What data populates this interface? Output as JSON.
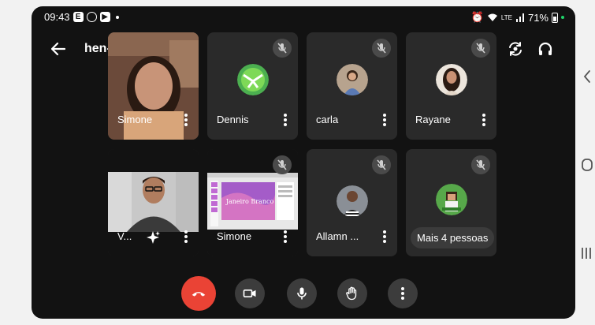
{
  "status": {
    "time": "09:43",
    "battery": "71%",
    "network": "LTE"
  },
  "header": {
    "title": "hen-xxcf-sux"
  },
  "participants": [
    {
      "name": "Simone"
    },
    {
      "name": "Dennis"
    },
    {
      "name": "carla"
    },
    {
      "name": "Rayane"
    },
    {
      "name": "V..."
    },
    {
      "name": "Simone"
    },
    {
      "name": "Allamn ..."
    },
    {
      "name": "Mais 4 pessoas"
    }
  ],
  "shared_slide": {
    "text": "Janeiro Branco"
  },
  "colors": {
    "hangup": "#ea4335",
    "tile": "#2a2a2a",
    "background": "#121212",
    "audio_badge": "#1f6fb6"
  },
  "icons": {
    "back": "arrow-left-icon",
    "switch_camera": "switch-camera-icon",
    "audio_output": "headphones-icon",
    "mic_off": "mic-off-icon",
    "hangup": "phone-hangup-icon",
    "camera": "video-camera-icon",
    "mic": "mic-icon",
    "hand": "raise-hand-icon",
    "more": "more-vert-icon"
  }
}
